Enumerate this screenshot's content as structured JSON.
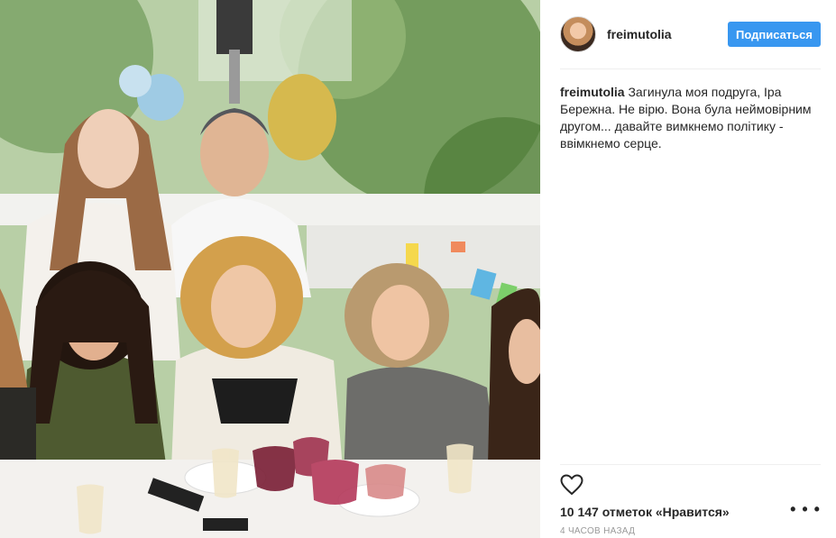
{
  "post": {
    "username": "freimutolia",
    "follow_label": "Подписаться",
    "caption_user": "freimutolia",
    "caption_text": "Загинула моя подруга, Іра Бережна. Не вірю. Вона була неймовірним другом... давайте вимкнемо політику - ввімкнемо серце.",
    "likes": "10 147 отметок «Нравится»",
    "time": "4 часов назад",
    "more_label": "• • •"
  },
  "colors": {
    "accent": "#3897f0",
    "text": "#262626",
    "muted": "#999999",
    "divider": "#efefef"
  },
  "icons": {
    "like": "heart-outline-icon",
    "options": "ellipsis-icon"
  }
}
